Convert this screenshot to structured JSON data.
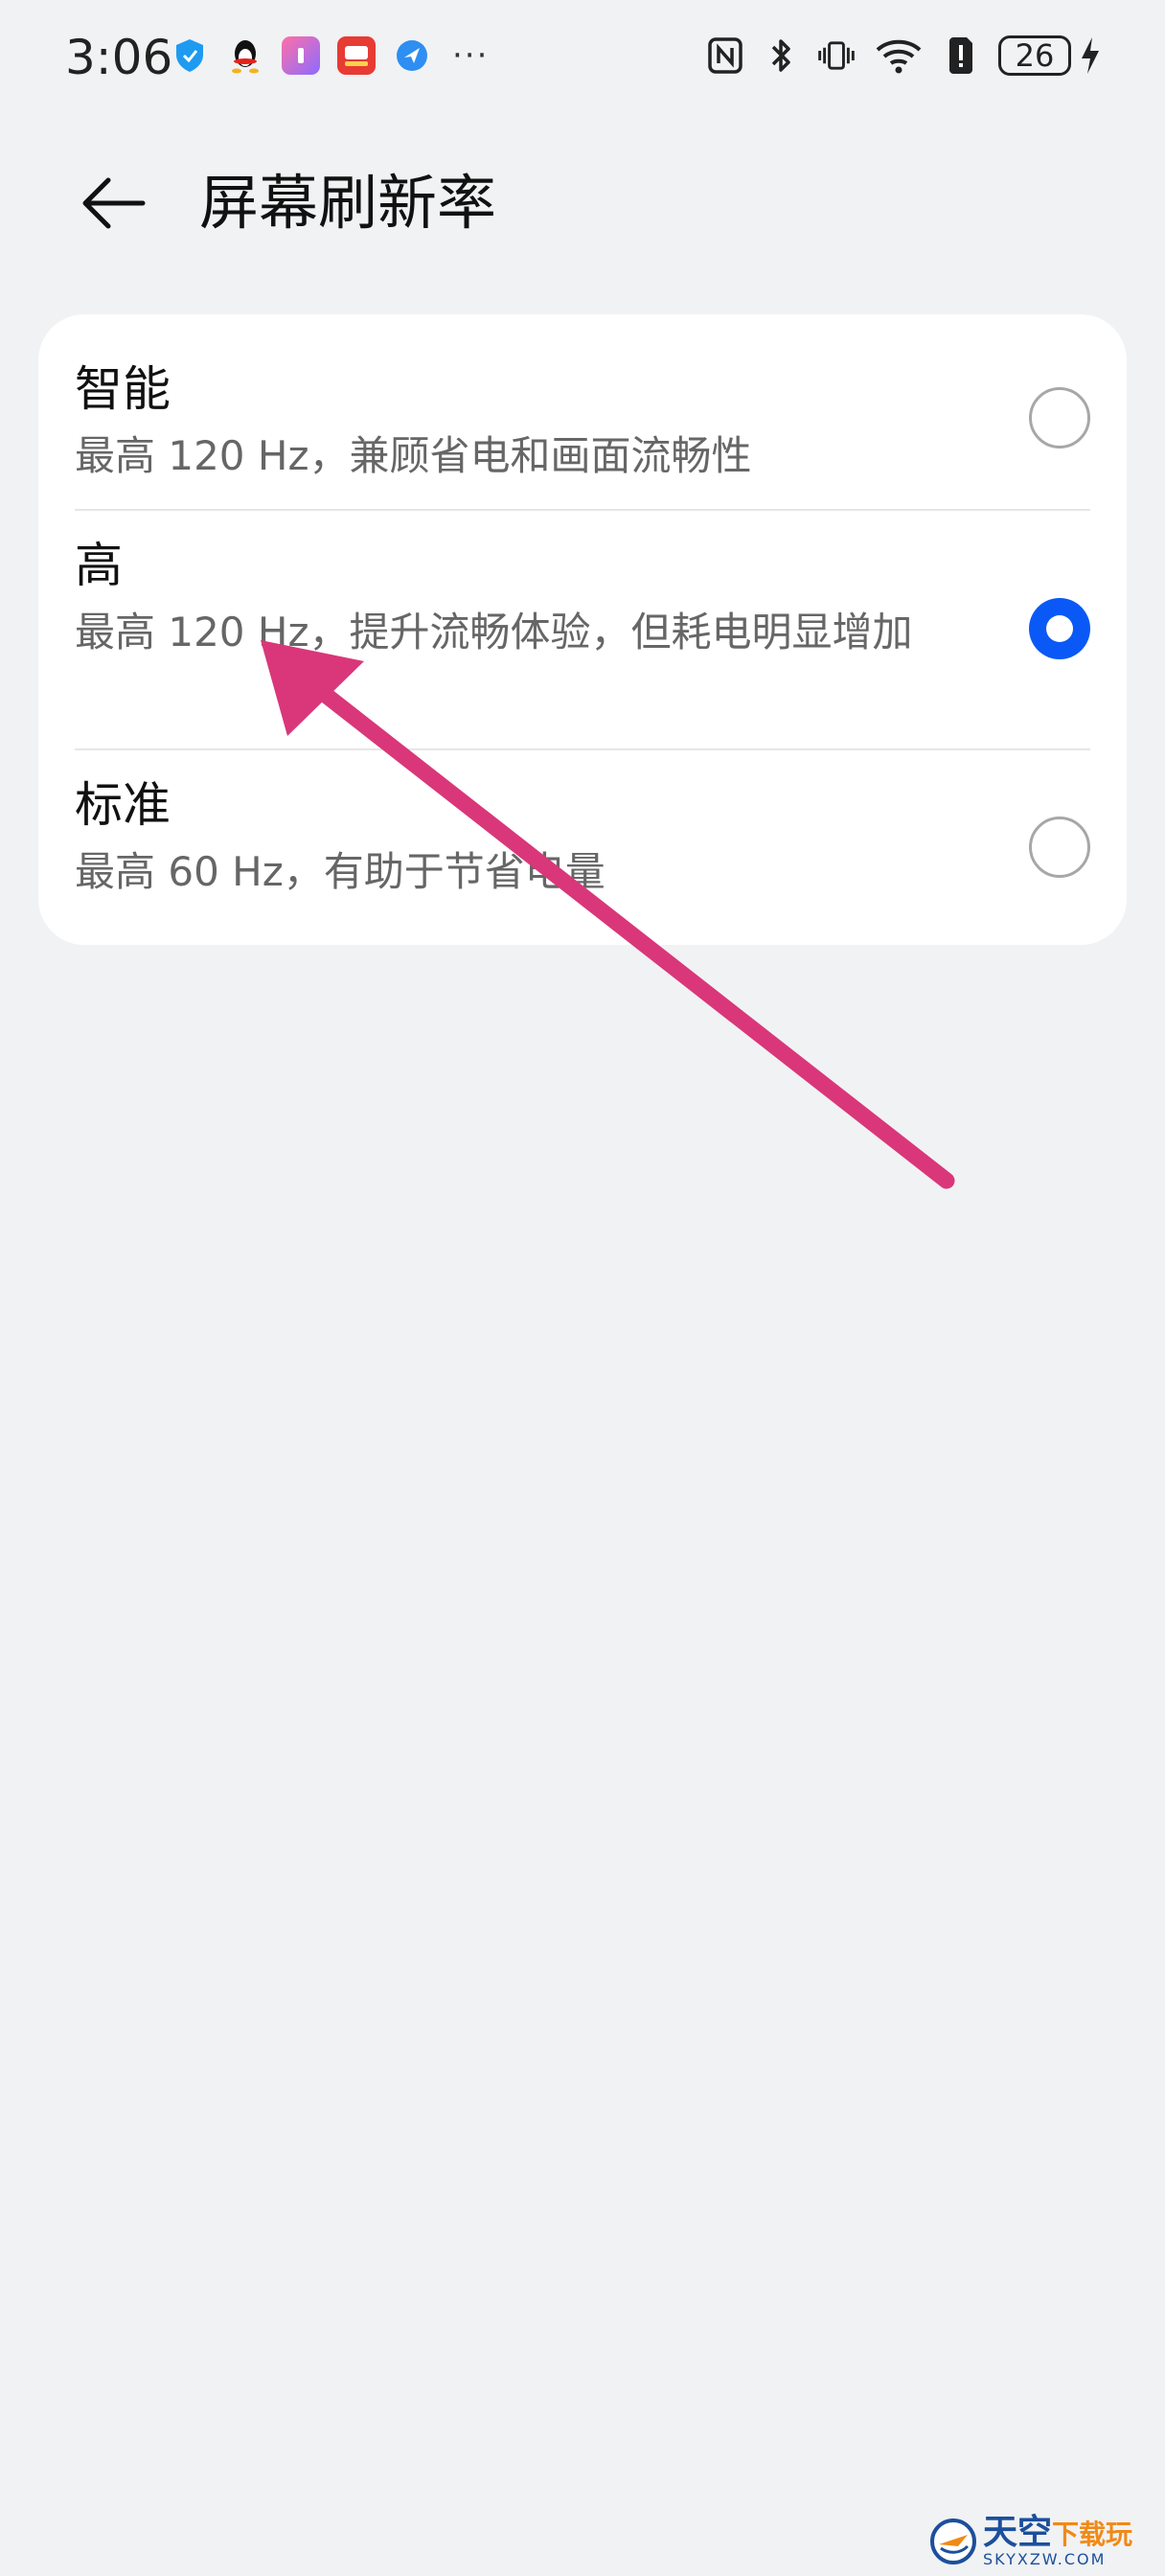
{
  "status_bar": {
    "time": "3:06",
    "more_label": "···",
    "battery_level": "26",
    "notification_icons": [
      "shield-app-icon",
      "qq-icon",
      "gallery-app-icon",
      "shop-app-icon",
      "browser-app-icon"
    ],
    "system_icons": [
      "nfc-icon",
      "bluetooth-icon",
      "vibrate-icon",
      "wifi-icon",
      "sim-alert-icon",
      "battery-icon",
      "charging-icon"
    ]
  },
  "header": {
    "title": "屏幕刷新率",
    "back_icon": "back-arrow-icon"
  },
  "options": [
    {
      "title": "智能",
      "description": "最高 120 Hz，兼顾省电和画面流畅性",
      "selected": false
    },
    {
      "title": "高",
      "description": "最高 120 Hz，提升流畅体验，但耗电明显增加",
      "selected": true
    },
    {
      "title": "标准",
      "description": "最高 60 Hz，有助于节省电量",
      "selected": false
    }
  ],
  "colors": {
    "background": "#f1f2f4",
    "card": "#ffffff",
    "accent": "#0a59f7",
    "annotation_arrow": "#d9377a"
  },
  "watermark": {
    "cn_main": "天空",
    "cn_sub": "下载玩",
    "en": "SKYXZW.COM"
  }
}
